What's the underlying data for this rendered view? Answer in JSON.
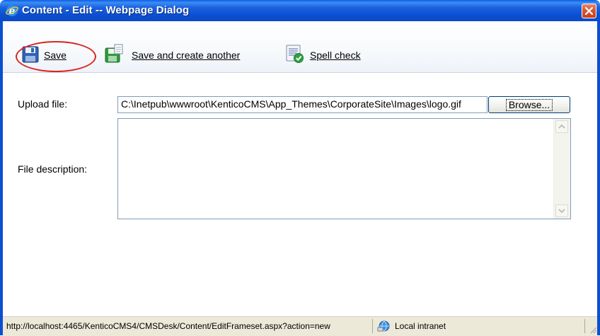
{
  "window": {
    "title": "Content - Edit -- Webpage Dialog"
  },
  "toolbar": {
    "save_label": "Save",
    "save_and_create_label": "Save and create another",
    "spell_check_label": "Spell check"
  },
  "form": {
    "upload_label": "Upload file:",
    "upload_value": "C:\\Inetpub\\wwwroot\\KenticoCMS\\App_Themes\\CorporateSite\\Images\\logo.gif",
    "browse_label": "Browse...",
    "description_label": "File description:",
    "description_value": ""
  },
  "statusbar": {
    "url": "http://localhost:4465/KenticoCMS4/CMSDesk/Content/EditFrameset.aspx?action=new",
    "zone": "Local intranet"
  },
  "icons": {
    "title": "ie-icon",
    "close": "close-icon",
    "save": "floppy-disk-icon",
    "save_and_create": "save-new-icon",
    "spell_check": "spell-check-icon",
    "zone": "local-intranet-icon",
    "grip": "resize-grip-icon"
  },
  "colors": {
    "titlebar": "#0a4fd2",
    "highlight": "#d9261e",
    "statusbar": "#ece9d8"
  }
}
